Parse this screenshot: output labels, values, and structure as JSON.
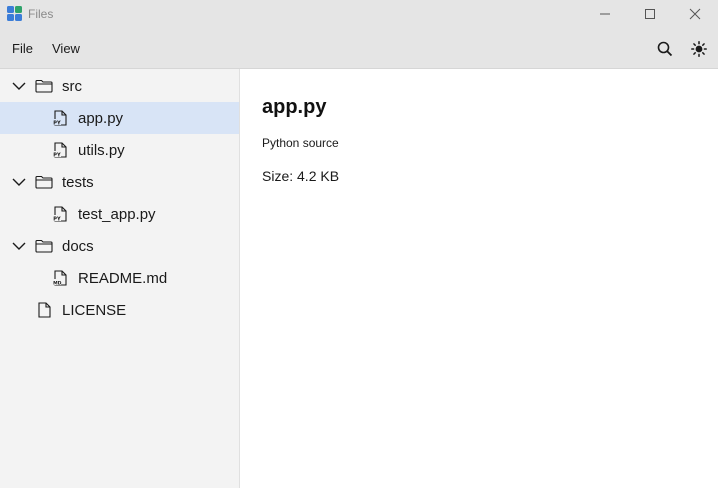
{
  "window": {
    "title": "Files"
  },
  "menu": {
    "file": "File",
    "view": "View"
  },
  "toolbar": {
    "search_icon": "search-icon",
    "theme_icon": "sun-icon"
  },
  "tree": {
    "src": {
      "label": "src",
      "expanded": true
    },
    "app_py": {
      "label": "app.py",
      "badge": "PY",
      "selected": true
    },
    "utils_py": {
      "label": "utils.py",
      "badge": "PY"
    },
    "tests": {
      "label": "tests",
      "expanded": true
    },
    "test_app_py": {
      "label": "test_app.py",
      "badge": "PY"
    },
    "docs": {
      "label": "docs",
      "expanded": true
    },
    "readme_md": {
      "label": "README.md",
      "badge": "MD"
    },
    "license": {
      "label": "LICENSE"
    }
  },
  "details": {
    "title": "app.py",
    "type": "Python source",
    "size": "Size: 4.2 KB"
  },
  "colors": {
    "selection": "#d8e4f6",
    "titlebar": "#e5e5e5",
    "sidebar": "#f3f3f3",
    "accent": "#3b7dd8"
  }
}
